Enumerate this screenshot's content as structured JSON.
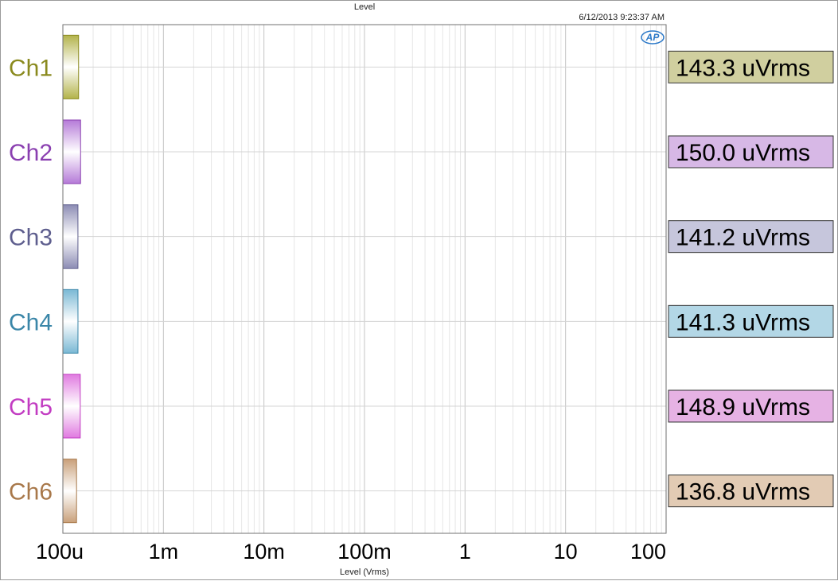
{
  "header": {
    "title": "Level",
    "timestamp": "6/12/2013 9:23:37 AM"
  },
  "logo": {
    "text": "AP",
    "color": "#2a78c8"
  },
  "chart_data": {
    "type": "bar",
    "orientation": "horizontal",
    "title": "Level",
    "xlabel": "Level (Vrms)",
    "ylabel": "",
    "xscale": "log",
    "xlim": [
      0.0001,
      100
    ],
    "grid": true,
    "xticks": [
      {
        "value": 0.0001,
        "label": "100u"
      },
      {
        "value": 0.001,
        "label": "1m"
      },
      {
        "value": 0.01,
        "label": "10m"
      },
      {
        "value": 0.1,
        "label": "100m"
      },
      {
        "value": 1,
        "label": "1"
      },
      {
        "value": 10,
        "label": "10"
      },
      {
        "value": 100,
        "label": "100"
      }
    ],
    "series": [
      {
        "name": "Ch1",
        "value": 0.0001433,
        "readout": "143.3 uVrms",
        "color": "#8a8a1e",
        "fill": "#b3b34a",
        "box": "#d0cf9f"
      },
      {
        "name": "Ch2",
        "value": 0.00015,
        "readout": "150.0 uVrms",
        "color": "#8a3fb0",
        "fill": "#b57ad8",
        "box": "#d7b8e6"
      },
      {
        "name": "Ch3",
        "value": 0.0001412,
        "readout": "141.2 uVrms",
        "color": "#5e5e8e",
        "fill": "#8c8cb4",
        "box": "#c6c6dc"
      },
      {
        "name": "Ch4",
        "value": 0.0001413,
        "readout": "141.3 uVrms",
        "color": "#3a86a8",
        "fill": "#7ab8d4",
        "box": "#b3d7e6"
      },
      {
        "name": "Ch5",
        "value": 0.0001489,
        "readout": "148.9 uVrms",
        "color": "#c23cc2",
        "fill": "#e07ae0",
        "box": "#e6b2e4"
      },
      {
        "name": "Ch6",
        "value": 0.0001368,
        "readout": "136.8 uVrms",
        "color": "#a8784a",
        "fill": "#c9a07a",
        "box": "#e2cbb4"
      }
    ]
  }
}
